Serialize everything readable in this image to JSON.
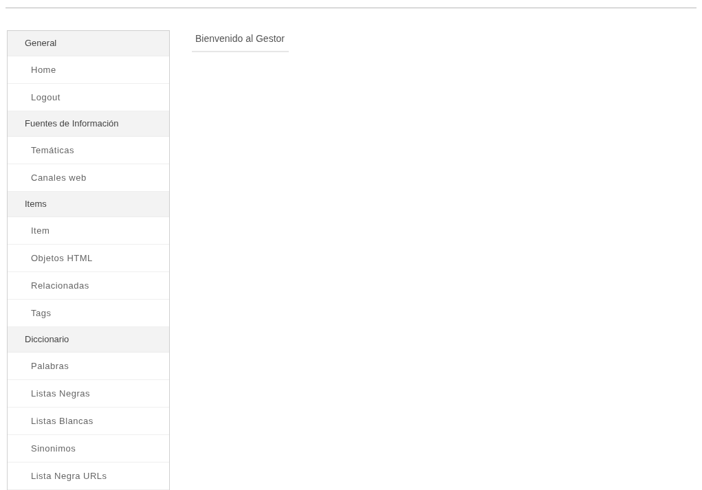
{
  "title": "Bienvenido al Gestor",
  "sidebar": {
    "sections": [
      {
        "heading": "General",
        "items": [
          "Home",
          "Logout"
        ]
      },
      {
        "heading": "Fuentes de Información",
        "items": [
          "Temáticas",
          "Canales web"
        ]
      },
      {
        "heading": "Items",
        "items": [
          "Item",
          "Objetos HTML",
          "Relacionadas",
          "Tags"
        ]
      },
      {
        "heading": "Diccionario",
        "items": [
          "Palabras",
          "Listas Negras",
          "Listas Blancas",
          "Sinonimos",
          "Lista Negra URLs"
        ]
      }
    ]
  }
}
